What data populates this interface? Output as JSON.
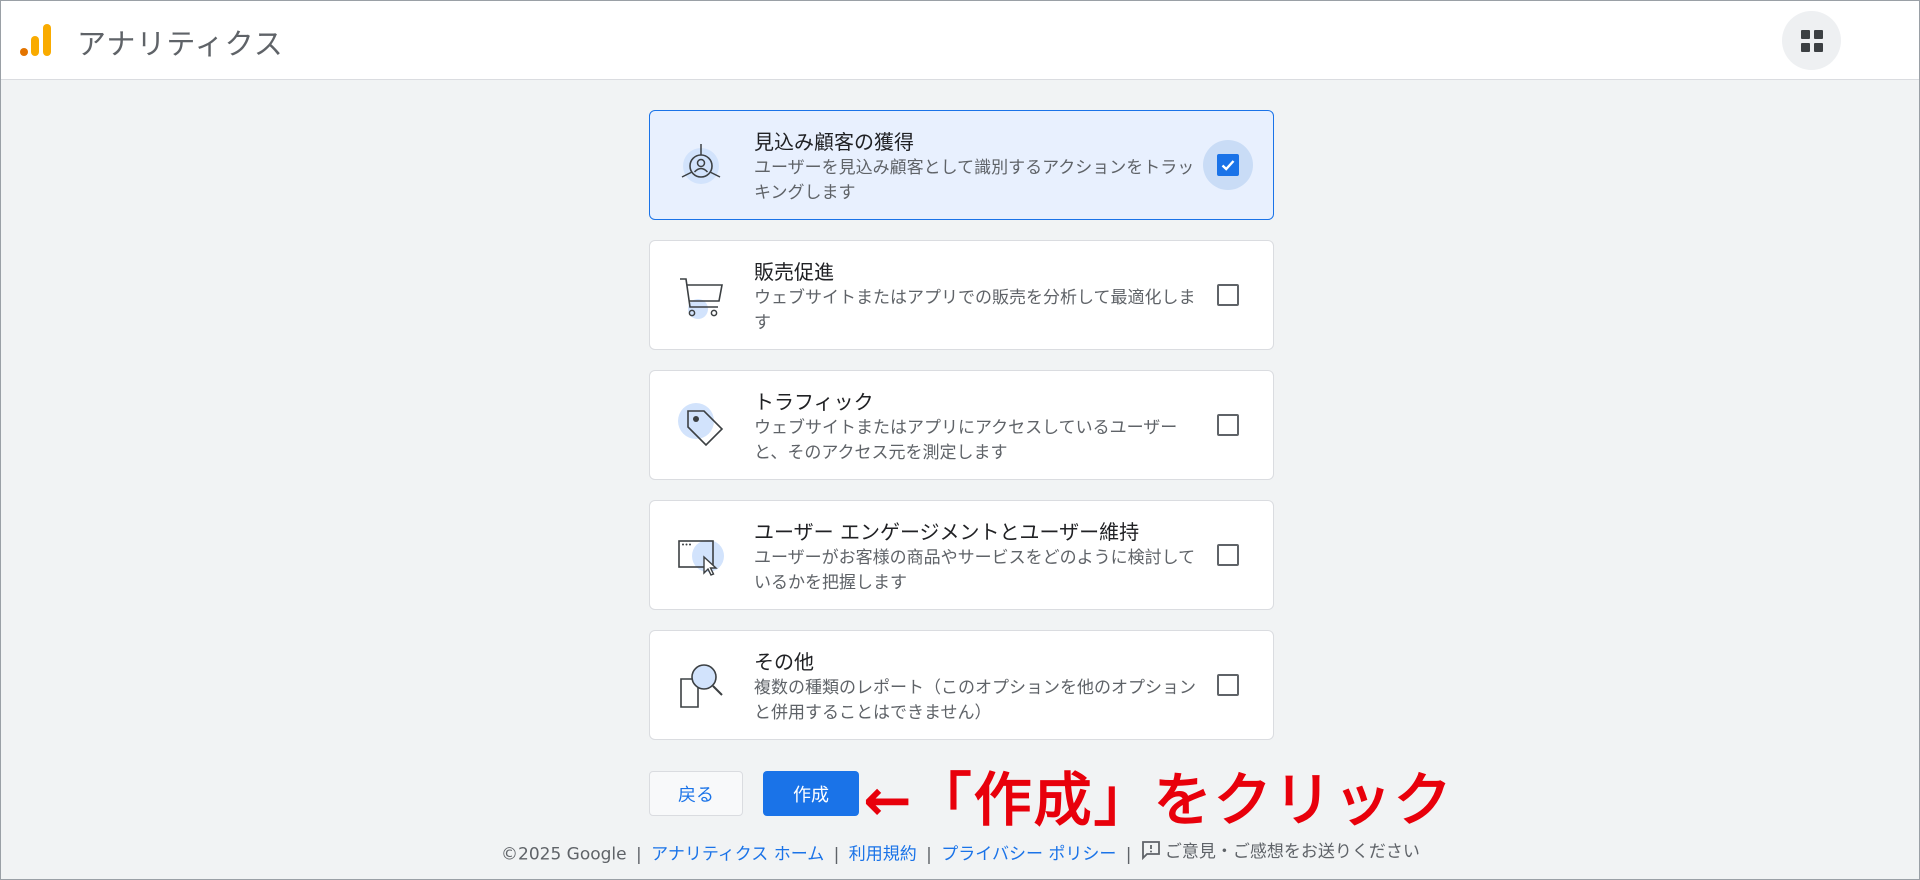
{
  "header": {
    "app_title": "アナリティクス",
    "logo_icon": "analytics-logo-icon",
    "apps_icon": "apps-grid-icon"
  },
  "options": [
    {
      "title": "見込み顧客の獲得",
      "description": "ユーザーを見込み顧客として識別するアクションをトラッキングします",
      "icon": "lead-target-icon",
      "checked": true
    },
    {
      "title": "販売促進",
      "description": "ウェブサイトまたはアプリでの販売を分析して最適化します",
      "icon": "shopping-cart-icon",
      "checked": false
    },
    {
      "title": "トラフィック",
      "description": "ウェブサイトまたはアプリにアクセスしているユーザーと、そのアクセス元を測定します",
      "icon": "tag-icon",
      "checked": false
    },
    {
      "title": "ユーザー エンゲージメントとユーザー維持",
      "description": "ユーザーがお客様の商品やサービスをどのように検討しているかを把握します",
      "icon": "browser-cursor-icon",
      "checked": false
    },
    {
      "title": "その他",
      "description": "複数の種類のレポート（このオプションを他のオプションと併用することはできません）",
      "icon": "magnifier-icon",
      "checked": false
    }
  ],
  "buttons": {
    "back_label": "戻る",
    "create_label": "作成"
  },
  "annotation": {
    "text": "←「作成」をクリック"
  },
  "footer": {
    "copyright": "©2025 Google",
    "separator": "|",
    "link_home": "アナリティクス ホーム",
    "link_terms": "利用規約",
    "link_privacy": "プライバシー ポリシー",
    "feedback_label": "ご意見・ご感想をお送りください",
    "feedback_icon": "feedback-icon"
  },
  "colors": {
    "accent": "#1a73e8",
    "selected_bg": "#e8f0fe",
    "annotation": "#e8000b",
    "logo_orange": "#f9ab00",
    "logo_dark_orange": "#e37400"
  }
}
